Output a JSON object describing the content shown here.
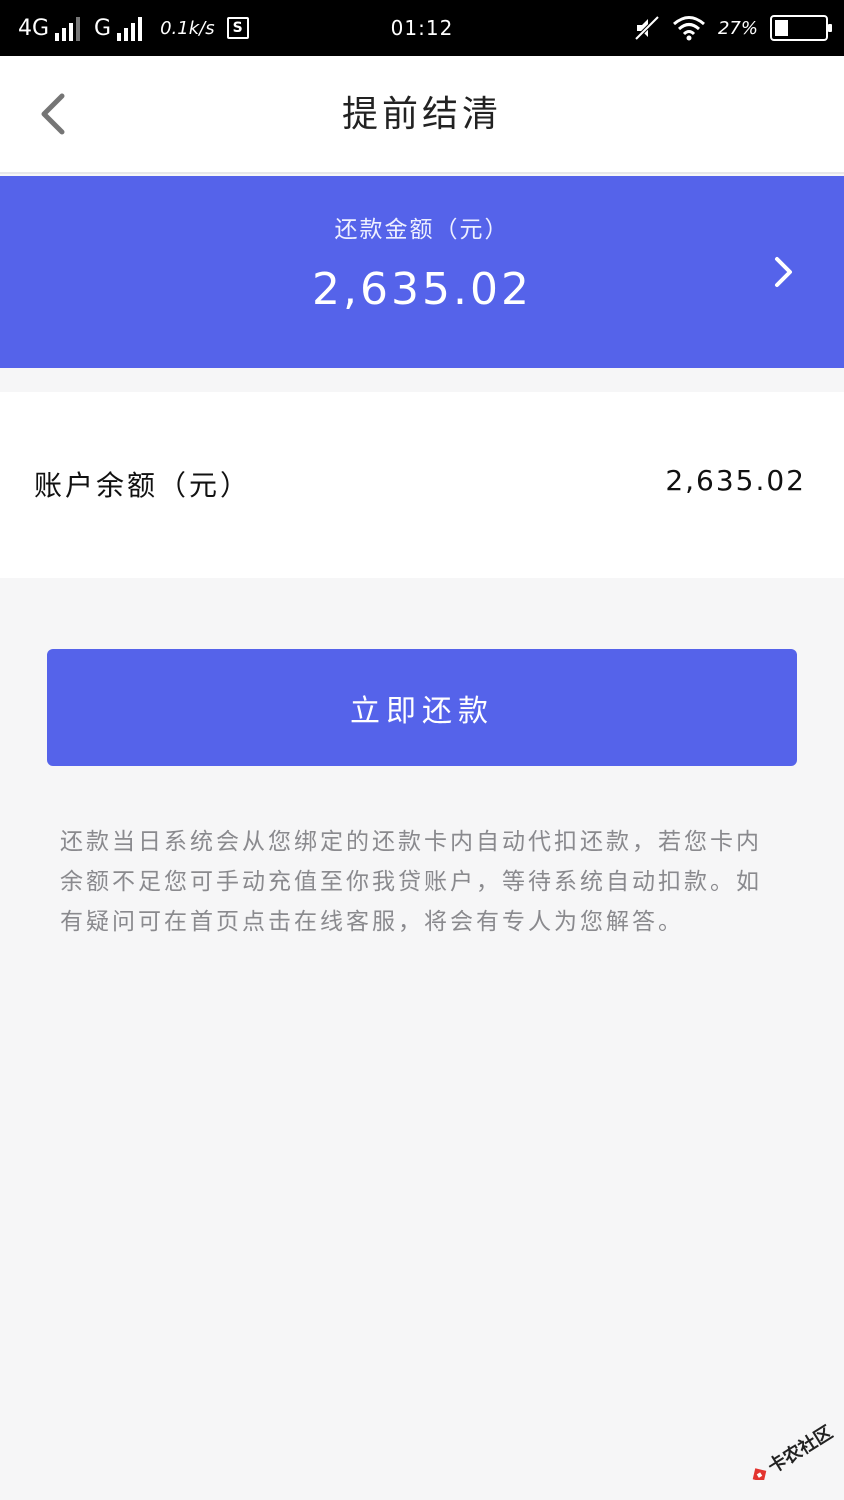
{
  "status_bar": {
    "network_1": "4G",
    "network_2": "G",
    "speed": "0.1k/s",
    "s_icon": "S",
    "time": "01:12",
    "battery": "27%",
    "icons": [
      "signal-icon",
      "mute-icon",
      "wifi-icon",
      "battery-icon"
    ]
  },
  "nav": {
    "title": "提前结清",
    "back_icon": "chevron-left-icon"
  },
  "summary": {
    "label": "还款金额（元）",
    "amount": "2,635.02",
    "arrow_icon": "chevron-right-icon"
  },
  "balance": {
    "label": "账户余额（元）",
    "value": "2,635.02"
  },
  "action": {
    "repay_label": "立即还款"
  },
  "notice": {
    "text": "还款当日系统会从您绑定的还款卡内自动代扣还款，若您卡内余额不足您可手动充值至你我贷账户，等待系统自动扣款。如有疑问可在首页点击在线客服，将会有专人为您解答。"
  },
  "watermark": {
    "text": "卡农社区"
  },
  "colors": {
    "accent": "#5563ea",
    "background": "#f6f6f7",
    "notice_text": "#8a8a8e"
  }
}
